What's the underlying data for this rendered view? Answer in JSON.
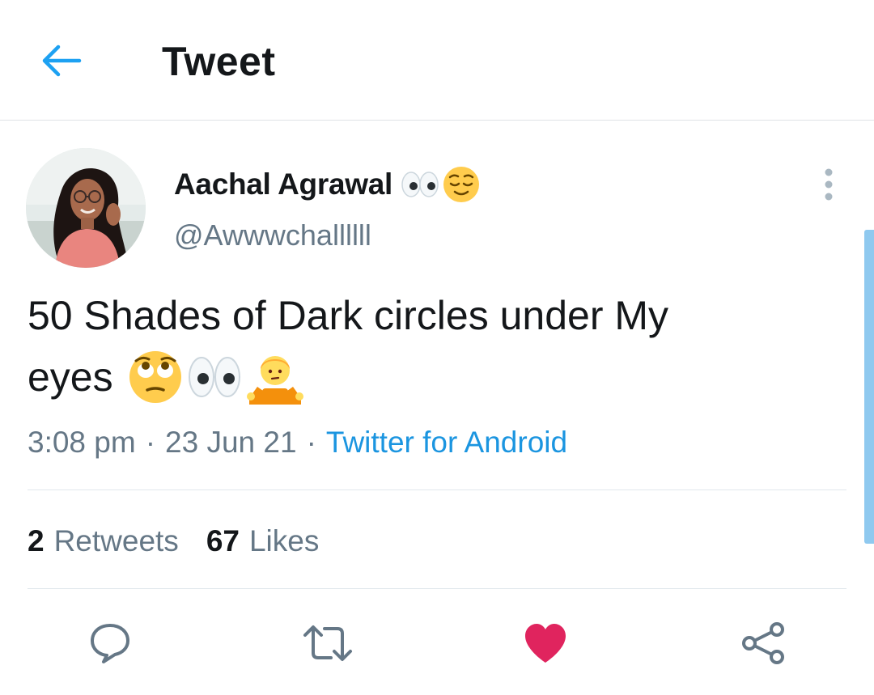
{
  "header": {
    "title": "Tweet",
    "back_icon": "arrow-left-icon"
  },
  "colors": {
    "accent": "#1da1f2",
    "source_link": "#1b95e0",
    "secondary_text": "#657786",
    "like_active": "#e0245e",
    "divider": "#e1e8ed",
    "scroll_indicator": "#8fc9ef"
  },
  "author": {
    "display_name": "Aachal Agrawal",
    "display_name_emoji": [
      "eyes-emoji",
      "relieved-face-emoji"
    ],
    "handle": "@Awwwchallllll"
  },
  "tweet": {
    "text_line1": "50 Shades of Dark circles under My",
    "text_line2": "eyes",
    "emoji": [
      "face-with-rolling-eyes-emoji",
      "eyes-emoji",
      "person-shrugging-emoji"
    ],
    "time": "3:08 pm",
    "date": "23 Jun 21",
    "source": "Twitter for Android",
    "separator": "·"
  },
  "stats": {
    "retweets_count": "2",
    "retweets_label": "Retweets",
    "likes_count": "67",
    "likes_label": "Likes"
  },
  "actions": [
    {
      "icon": "reply-icon"
    },
    {
      "icon": "retweet-icon"
    },
    {
      "icon": "heart-icon",
      "liked": true
    },
    {
      "icon": "share-icon"
    }
  ]
}
